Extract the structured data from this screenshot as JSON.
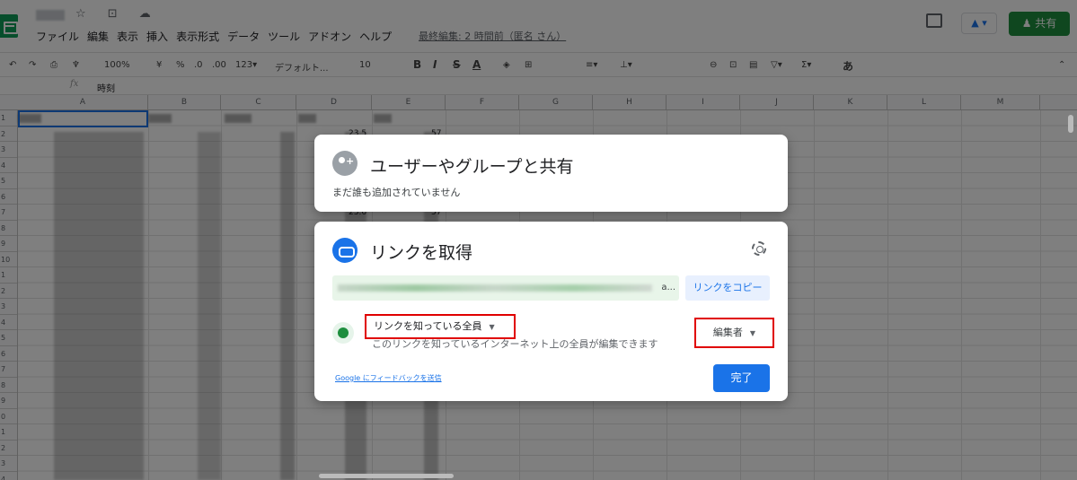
{
  "header": {
    "title_icons": "☆ ⊡ ☁",
    "menu": [
      "ファイル",
      "編集",
      "表示",
      "挿入",
      "表示形式",
      "データ",
      "ツール",
      "アドオン",
      "ヘルプ"
    ],
    "last_edit": "最終編集: 2 時間前（匿名 さん）",
    "present_label": "▲ ▾",
    "share_label": "共有"
  },
  "toolbar": {
    "zoom": "100%",
    "currency": "¥",
    "percent": "%",
    "dec_decrease": ".0",
    "dec_increase": ".00",
    "format_num": "123▾",
    "font": "デフォルト...",
    "font_size": "10",
    "bold": "B",
    "italic": "I",
    "strike": "S",
    "text_color": "A",
    "input_method": "あ"
  },
  "formula_bar": {
    "fx": "fx",
    "value": "時刻"
  },
  "grid": {
    "columns": [
      "A",
      "B",
      "C",
      "D",
      "E",
      "F",
      "G",
      "H",
      "I",
      "J",
      "K",
      "L",
      "M"
    ],
    "rows": [
      "1",
      "2",
      "3",
      "4",
      "5",
      "6",
      "7",
      "8",
      "9",
      "10",
      "1",
      "2",
      "3",
      "4",
      "5",
      "6",
      "7",
      "8",
      "9",
      "0",
      "1",
      "2",
      "3",
      "4"
    ],
    "visible_values": {
      "d2": "23.5",
      "e2": "57",
      "d7": "23.6",
      "e7": "57"
    }
  },
  "share_dialog": {
    "title": "ユーザーやグループと共有",
    "subtitle": "まだ誰も追加されていません"
  },
  "link_dialog": {
    "title": "リンクを取得",
    "link_suffix": "a...",
    "copy_button": "リンクをコピー",
    "scope_label": "リンクを知っている全員",
    "scope_description": "このリンクを知っているインターネット上の全員が編集できます",
    "role_label": "編集者",
    "feedback_link": "Google にフィードバックを送信",
    "done_button": "完了"
  },
  "colors": {
    "accent": "#1a73e8",
    "share_green": "#1e8e3e",
    "highlight_red": "#e00000"
  }
}
